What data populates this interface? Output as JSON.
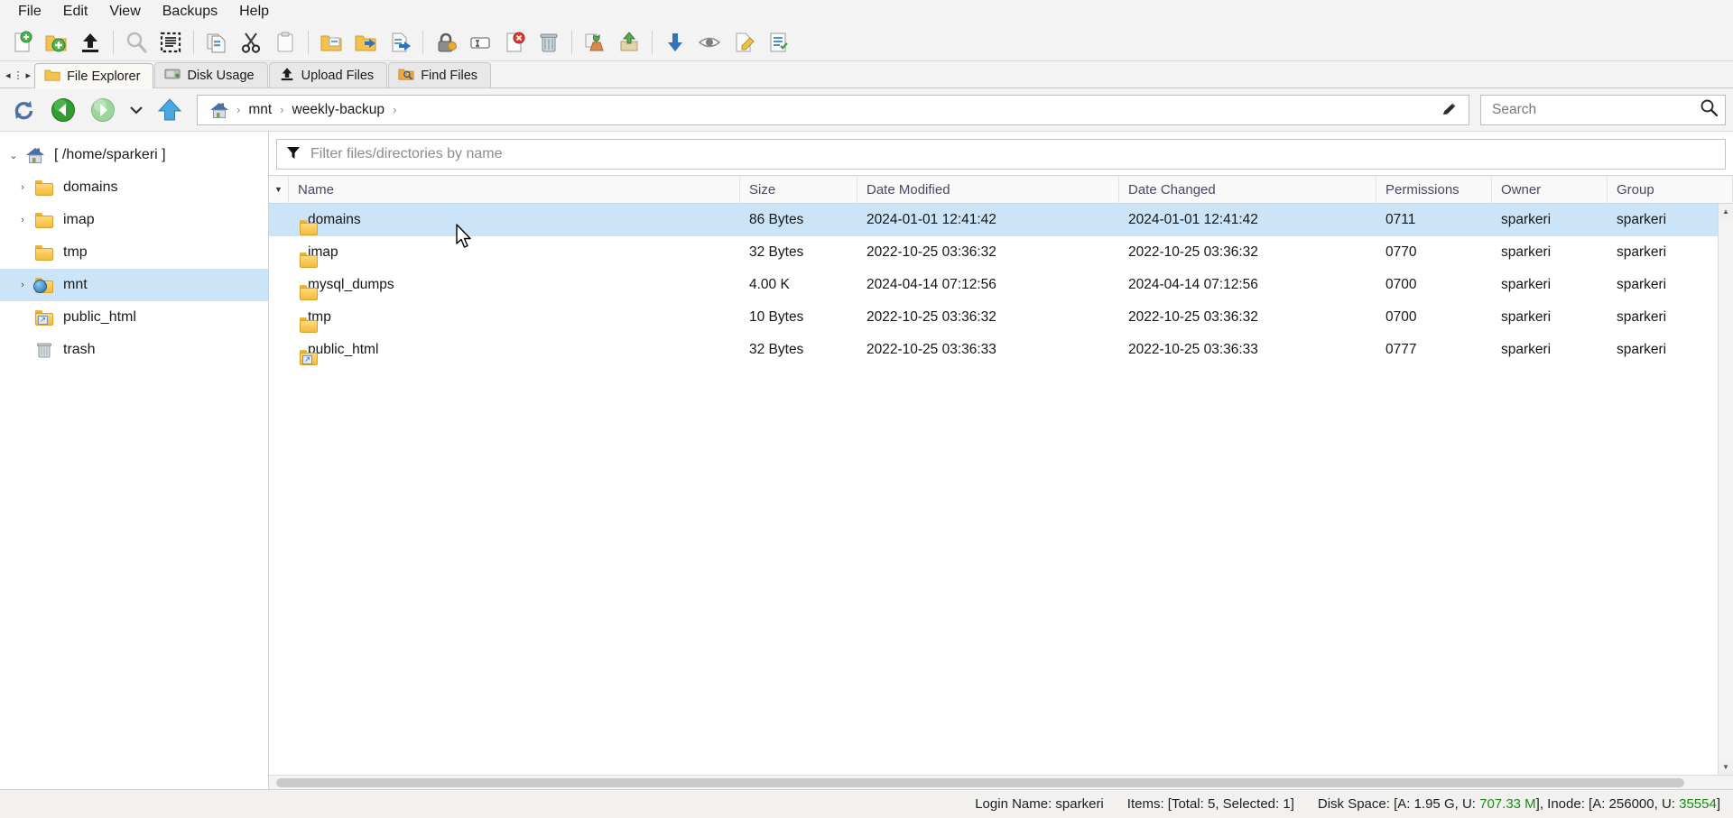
{
  "menubar": {
    "items": [
      {
        "label": "File",
        "name": "menu-file"
      },
      {
        "label": "Edit",
        "name": "menu-edit"
      },
      {
        "label": "View",
        "name": "menu-view"
      },
      {
        "label": "Backups",
        "name": "menu-backups"
      },
      {
        "label": "Help",
        "name": "menu-help"
      }
    ]
  },
  "toolbar": {
    "buttons": [
      {
        "icon": "new-file-icon",
        "group": 0
      },
      {
        "icon": "new-folder-icon",
        "group": 0
      },
      {
        "icon": "upload-icon",
        "group": 0
      },
      {
        "icon": "search-icon",
        "group": 1
      },
      {
        "icon": "select-all-icon",
        "group": 1
      },
      {
        "icon": "copy-icon",
        "group": 2
      },
      {
        "icon": "cut-icon",
        "group": 2
      },
      {
        "icon": "paste-icon",
        "group": 2
      },
      {
        "icon": "copy-to-folder-icon",
        "group": 3
      },
      {
        "icon": "move-to-folder-icon",
        "group": 3
      },
      {
        "icon": "move-file-icon",
        "group": 3
      },
      {
        "icon": "permissions-lock-icon",
        "group": 4
      },
      {
        "icon": "rename-icon",
        "group": 4
      },
      {
        "icon": "delete-file-icon",
        "group": 4
      },
      {
        "icon": "trash-icon",
        "group": 4
      },
      {
        "icon": "restore-icon",
        "group": 5
      },
      {
        "icon": "archive-extract-icon",
        "group": 5
      },
      {
        "icon": "download-icon",
        "group": 6
      },
      {
        "icon": "view-icon",
        "group": 6
      },
      {
        "icon": "edit-icon",
        "group": 6
      },
      {
        "icon": "properties-icon",
        "group": 6
      }
    ]
  },
  "tabs": {
    "items": [
      {
        "label": "File Explorer",
        "icon": "folder-icon",
        "active": true
      },
      {
        "label": "Disk Usage",
        "icon": "disk-icon",
        "active": false
      },
      {
        "label": "Upload Files",
        "icon": "upload-icon",
        "active": false
      },
      {
        "label": "Find Files",
        "icon": "find-icon",
        "active": false
      }
    ]
  },
  "nav": {
    "refresh": "refresh-icon",
    "back": "back-icon",
    "forward": "forward-icon",
    "history_dropdown": "chevron-down-icon",
    "up": "up-arrow-icon",
    "edit_path": "pencil-icon"
  },
  "breadcrumb": {
    "home_icon": "home-icon",
    "separator": "›",
    "crumbs": [
      "mnt",
      "weekly-backup"
    ]
  },
  "search": {
    "placeholder": "Search",
    "value": "",
    "icon": "search-icon"
  },
  "filter": {
    "placeholder": "Filter files/directories by name",
    "value": "",
    "icon": "funnel-icon"
  },
  "sidebar": {
    "nodes": [
      {
        "label": "[ /home/sparkeri ]",
        "icon": "home-folder-icon",
        "twisty": "⌄",
        "level": 0,
        "selected": false
      },
      {
        "label": "domains",
        "icon": "folder-icon",
        "twisty": "›",
        "level": 1,
        "selected": false
      },
      {
        "label": "imap",
        "icon": "folder-icon",
        "twisty": "›",
        "level": 1,
        "selected": false
      },
      {
        "label": "tmp",
        "icon": "folder-icon",
        "twisty": "",
        "level": 1,
        "selected": false
      },
      {
        "label": "mnt",
        "icon": "folder-globe-icon",
        "twisty": "›",
        "level": 1,
        "selected": true
      },
      {
        "label": "public_html",
        "icon": "folder-symlink-icon",
        "twisty": "",
        "level": 1,
        "selected": false
      },
      {
        "label": "trash",
        "icon": "trash-icon",
        "twisty": "",
        "level": 1,
        "selected": false
      }
    ]
  },
  "table": {
    "sort_indicator": "▼",
    "columns": [
      {
        "label": "Name",
        "key": "name"
      },
      {
        "label": "Size",
        "key": "size"
      },
      {
        "label": "Date Modified",
        "key": "date_modified"
      },
      {
        "label": "Date Changed",
        "key": "date_changed"
      },
      {
        "label": "Permissions",
        "key": "permissions"
      },
      {
        "label": "Owner",
        "key": "owner"
      },
      {
        "label": "Group",
        "key": "group"
      }
    ],
    "rows": [
      {
        "name": "domains",
        "icon": "folder-icon",
        "size": "86 Bytes",
        "date_modified": "2024-01-01 12:41:42",
        "date_changed": "2024-01-01 12:41:42",
        "permissions": "0711",
        "owner": "sparkeri",
        "group": "sparkeri",
        "selected": true
      },
      {
        "name": "imap",
        "icon": "folder-icon",
        "size": "32 Bytes",
        "date_modified": "2022-10-25 03:36:32",
        "date_changed": "2022-10-25 03:36:32",
        "permissions": "0770",
        "owner": "sparkeri",
        "group": "sparkeri",
        "selected": false
      },
      {
        "name": "mysql_dumps",
        "icon": "folder-icon",
        "size": "4.00 K",
        "date_modified": "2024-04-14 07:12:56",
        "date_changed": "2024-04-14 07:12:56",
        "permissions": "0700",
        "owner": "sparkeri",
        "group": "sparkeri",
        "selected": false
      },
      {
        "name": "tmp",
        "icon": "folder-icon",
        "size": "10 Bytes",
        "date_modified": "2022-10-25 03:36:32",
        "date_changed": "2022-10-25 03:36:32",
        "permissions": "0700",
        "owner": "sparkeri",
        "group": "sparkeri",
        "selected": false
      },
      {
        "name": "public_html",
        "icon": "folder-symlink-icon",
        "size": "32 Bytes",
        "date_modified": "2022-10-25 03:36:33",
        "date_changed": "2022-10-25 03:36:33",
        "permissions": "0777",
        "owner": "sparkeri",
        "group": "sparkeri",
        "selected": false
      }
    ]
  },
  "statusbar": {
    "login_name": "Login Name: sparkeri",
    "items": "Items: [Total: 5, Selected: 1]",
    "disk_prefix": "Disk Space: [A: 1.95 G, U: ",
    "disk_used": "707.33 M",
    "disk_mid": "], Inode: [A: 256000, U: ",
    "inode_used": "35554",
    "disk_suffix": "]",
    "highlight_color": "#1a8a1a"
  }
}
